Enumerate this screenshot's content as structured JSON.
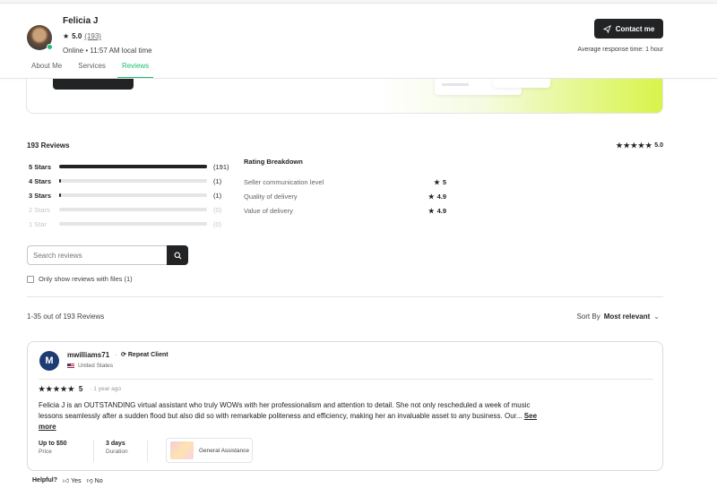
{
  "seller": {
    "name": "Felicia J",
    "rating": "5.0",
    "rating_count": "(193)",
    "status": "Online • 11:57 AM local time",
    "contact_label": "Contact me",
    "response_time": "Average response time: 1 hour"
  },
  "tabs": [
    {
      "label": "About Me",
      "active": false
    },
    {
      "label": "Services",
      "active": false
    },
    {
      "label": "Reviews",
      "active": true
    }
  ],
  "summary": {
    "reviews_count": "193 Reviews",
    "overall_rating": "5.0",
    "bars": [
      {
        "label": "5 Stars",
        "count": "(191)",
        "fraction": 1.0,
        "enabled": true
      },
      {
        "label": "4 Stars",
        "count": "(1)",
        "fraction": 0.01,
        "enabled": true
      },
      {
        "label": "3 Stars",
        "count": "(1)",
        "fraction": 0.01,
        "enabled": true
      },
      {
        "label": "2 Stars",
        "count": "(0)",
        "fraction": 0,
        "enabled": false
      },
      {
        "label": "1 Star",
        "count": "(0)",
        "fraction": 0,
        "enabled": false
      }
    ],
    "breakdown_title": "Rating Breakdown",
    "breakdown": [
      {
        "label": "Seller communication level",
        "value": "5"
      },
      {
        "label": "Quality of delivery",
        "value": "4.9"
      },
      {
        "label": "Value of delivery",
        "value": "4.9"
      }
    ]
  },
  "search": {
    "placeholder": "Search reviews",
    "files_filter_label": "Only show reviews with files (1)"
  },
  "list": {
    "range": "1-35 out of 193 Reviews",
    "sort_label": "Sort By",
    "sort_value": "Most relevant"
  },
  "review": {
    "avatar_letter": "M",
    "username": "mwilliams71",
    "badge": "Repeat Client",
    "country": "United States",
    "rating": "5",
    "time": "1 year ago",
    "text": "Felicia J is an OUTSTANDING virtual assistant who truly WOWs with her professionalism and attention to detail. She not only rescheduled a week of music lessons seamlessly after a sudden flood but also did so with remarkable politeness and efficiency, making her an invaluable asset to any business. Our...",
    "see_more": "See more",
    "price_value": "Up to $50",
    "price_label": "Price",
    "duration_value": "3 days",
    "duration_label": "Duration",
    "service": "General Assistance"
  },
  "helpful": {
    "label": "Helpful?",
    "yes": "Yes",
    "no": "No"
  },
  "colors": {
    "accent": "#1dbf73",
    "dark": "#222325",
    "banner_lime": "#d8f44a"
  }
}
